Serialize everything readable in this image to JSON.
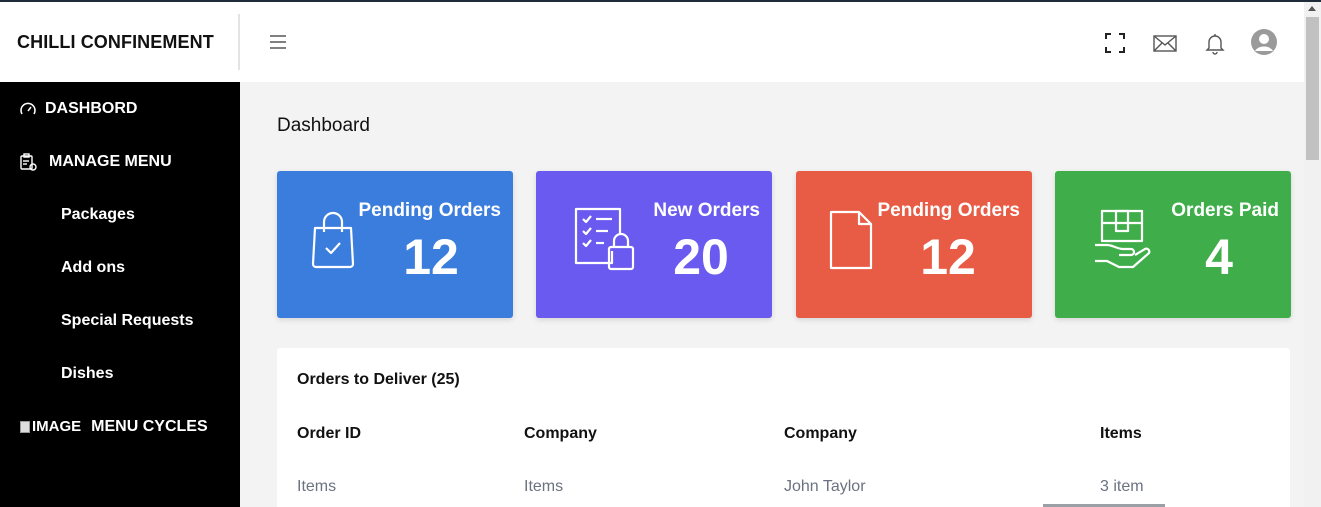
{
  "brand": {
    "name": "CHILLI CONFINEMENT"
  },
  "header": {
    "icons": [
      "menu-icon",
      "fullscreen-icon",
      "mail-icon",
      "bell-icon",
      "user-avatar-icon"
    ]
  },
  "sidebar": {
    "items": [
      {
        "label": "DASHBORD",
        "icon": "dashboard-gauge-icon"
      },
      {
        "label": "MANAGE MENU",
        "icon": "clipboard-gear-icon"
      },
      {
        "label": "Packages"
      },
      {
        "label": "Add ons"
      },
      {
        "label": "Special Requests"
      },
      {
        "label": "Dishes"
      },
      {
        "label": "MENU CYCLES",
        "image_alt": "IMAGE"
      }
    ]
  },
  "page": {
    "title": "Dashboard"
  },
  "cards": [
    {
      "label": "Pending Orders",
      "value": "12",
      "color": "#3b7ddd",
      "icon": "shopping-bag-check-icon"
    },
    {
      "label": "New Orders",
      "value": "20",
      "color": "#6a5af0",
      "icon": "checklist-lock-icon"
    },
    {
      "label": "Pending Orders",
      "value": "12",
      "color": "#e85c45",
      "icon": "document-icon"
    },
    {
      "label": "Orders Paid",
      "value": "4",
      "color": "#3fae4a",
      "icon": "hand-package-icon"
    }
  ],
  "orders_table": {
    "title": "Orders to Deliver (25)",
    "columns": [
      "Order ID",
      "Company",
      "Company",
      "Items"
    ],
    "rows": [
      [
        "Items",
        "Items",
        "John Taylor",
        "3 item"
      ]
    ]
  }
}
